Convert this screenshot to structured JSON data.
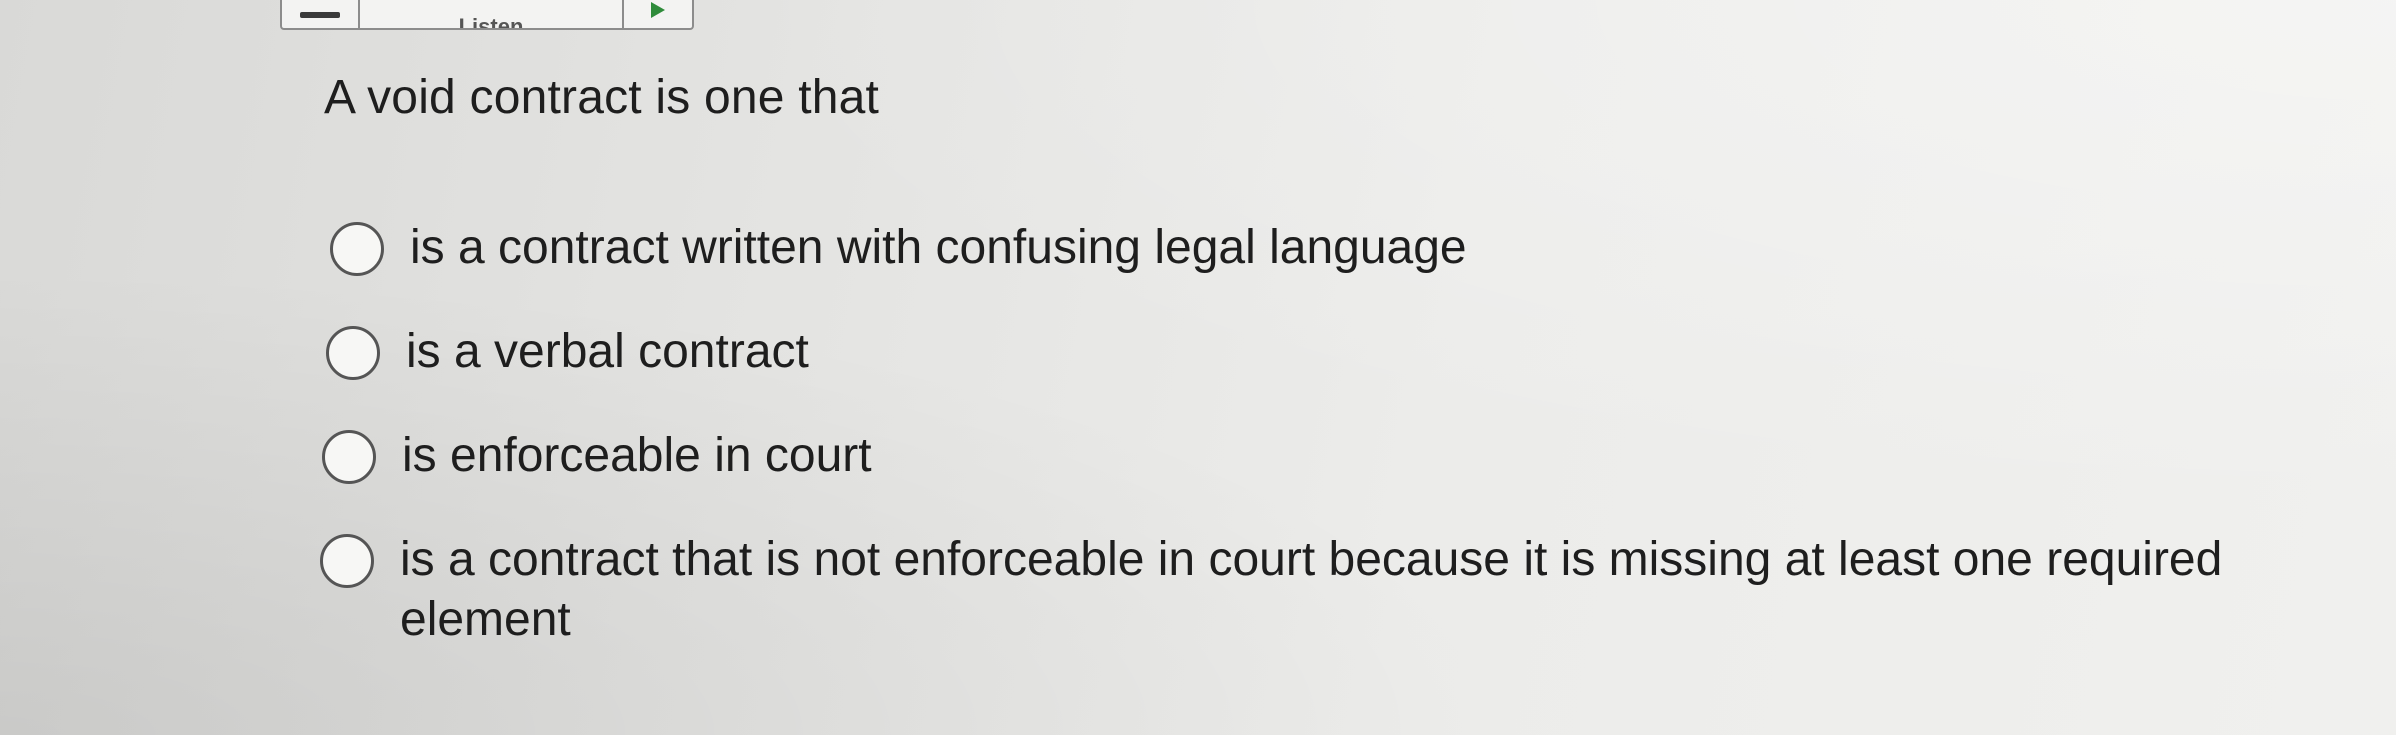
{
  "toolbar": {
    "listen_label": "Listen"
  },
  "question": {
    "prompt": "A void contract is one that",
    "options": [
      {
        "label": "is a contract written with confusing legal language",
        "selected": false
      },
      {
        "label": "is a verbal contract",
        "selected": false
      },
      {
        "label": "is enforceable in court",
        "selected": false
      },
      {
        "label": "is a contract that is not enforceable in court because it is missing at least one required element",
        "selected": false
      }
    ]
  }
}
